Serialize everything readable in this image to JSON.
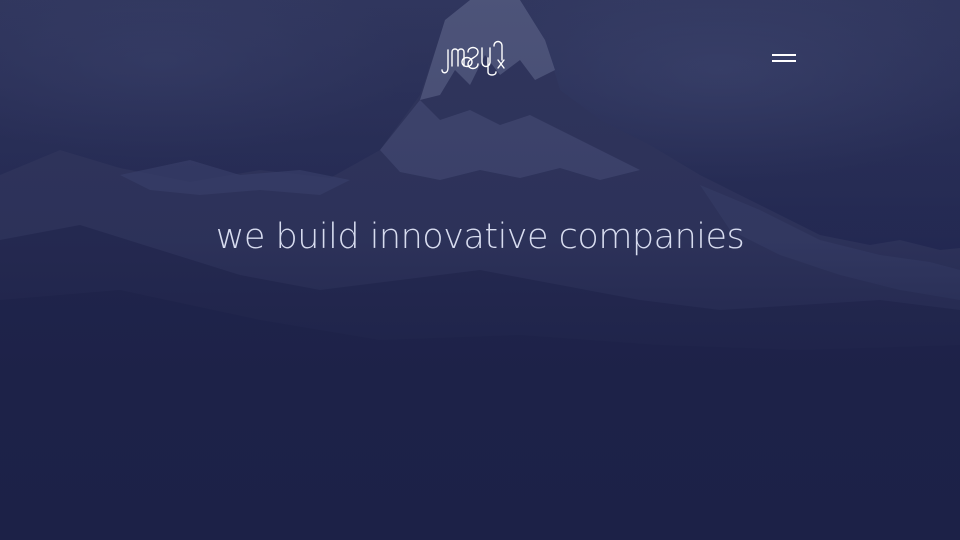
{
  "brand": {
    "logo_text": "muoffice"
  },
  "header": {
    "menu_icon": "hamburger-menu-icon"
  },
  "hero": {
    "headline": "we build innovative companies"
  },
  "colors": {
    "background": "#1c2147",
    "text": "#d7dcef",
    "icon": "#ffffff"
  }
}
